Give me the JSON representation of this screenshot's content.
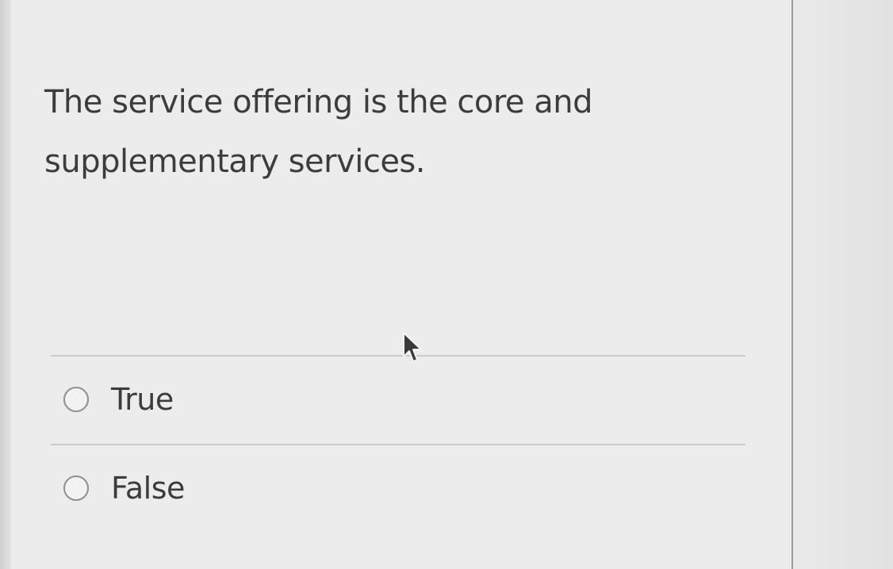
{
  "question": {
    "text": "The service offering is the core and supplementary services."
  },
  "options": [
    {
      "label": "True",
      "selected": false
    },
    {
      "label": "False",
      "selected": false
    }
  ],
  "icons": {
    "cursor": "mouse-pointer-icon",
    "radio": "radio-button-icon"
  },
  "colors": {
    "text": "#3c3c3c",
    "background": "#ececec",
    "divider": "#cbcbcb",
    "radio_border": "#8f8f8f"
  }
}
